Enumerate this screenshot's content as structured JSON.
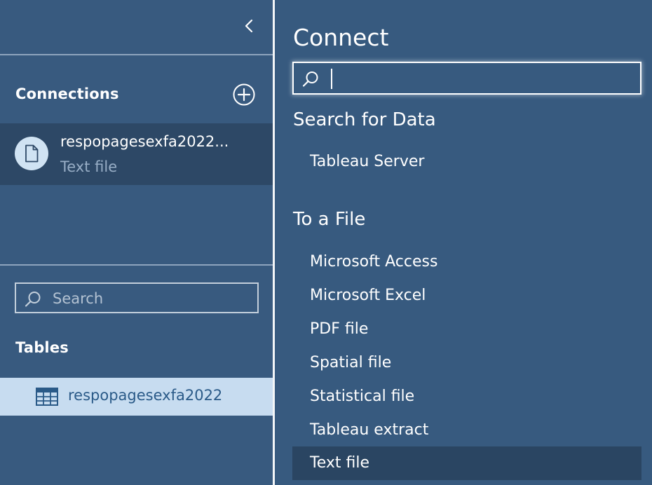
{
  "sidebar": {
    "connections_label": "Connections",
    "connection": {
      "name": "respopagesexfa2022...",
      "type": "Text file"
    },
    "search_placeholder": "Search",
    "tables_label": "Tables",
    "table": {
      "name": "respopagesexfa2022"
    }
  },
  "connect": {
    "title": "Connect",
    "search_value": "",
    "search_for_data_heading": "Search for Data",
    "search_for_data_items": [
      "Tableau Server"
    ],
    "to_a_file_heading": "To a File",
    "to_a_file_items": [
      "Microsoft Access",
      "Microsoft Excel",
      "PDF file",
      "Spatial file",
      "Statistical file",
      "Tableau extract",
      "Text file"
    ],
    "selected_item": "Text file"
  },
  "icons": {
    "collapse": "chevron-left-icon",
    "add": "plus-circle-icon",
    "file": "file-icon",
    "search": "search-icon",
    "table": "table-grid-icon"
  },
  "colors": {
    "panel_bg": "#375a7f",
    "selected_connection_bg": "#2d4866",
    "selected_table_bg": "#c7dcf0",
    "selected_link_bg": "#2a4562",
    "muted_text": "#98aec6",
    "table_text": "#2a5a88"
  }
}
